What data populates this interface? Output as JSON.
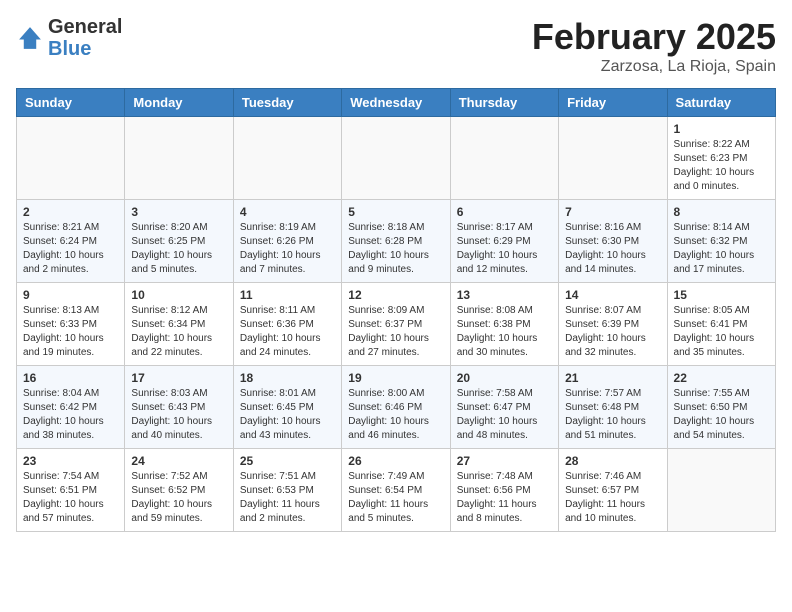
{
  "header": {
    "logo_general": "General",
    "logo_blue": "Blue",
    "month_title": "February 2025",
    "location": "Zarzosa, La Rioja, Spain"
  },
  "days_of_week": [
    "Sunday",
    "Monday",
    "Tuesday",
    "Wednesday",
    "Thursday",
    "Friday",
    "Saturday"
  ],
  "weeks": [
    [
      {
        "day": "",
        "info": ""
      },
      {
        "day": "",
        "info": ""
      },
      {
        "day": "",
        "info": ""
      },
      {
        "day": "",
        "info": ""
      },
      {
        "day": "",
        "info": ""
      },
      {
        "day": "",
        "info": ""
      },
      {
        "day": "1",
        "info": "Sunrise: 8:22 AM\nSunset: 6:23 PM\nDaylight: 10 hours\nand 0 minutes."
      }
    ],
    [
      {
        "day": "2",
        "info": "Sunrise: 8:21 AM\nSunset: 6:24 PM\nDaylight: 10 hours\nand 2 minutes."
      },
      {
        "day": "3",
        "info": "Sunrise: 8:20 AM\nSunset: 6:25 PM\nDaylight: 10 hours\nand 5 minutes."
      },
      {
        "day": "4",
        "info": "Sunrise: 8:19 AM\nSunset: 6:26 PM\nDaylight: 10 hours\nand 7 minutes."
      },
      {
        "day": "5",
        "info": "Sunrise: 8:18 AM\nSunset: 6:28 PM\nDaylight: 10 hours\nand 9 minutes."
      },
      {
        "day": "6",
        "info": "Sunrise: 8:17 AM\nSunset: 6:29 PM\nDaylight: 10 hours\nand 12 minutes."
      },
      {
        "day": "7",
        "info": "Sunrise: 8:16 AM\nSunset: 6:30 PM\nDaylight: 10 hours\nand 14 minutes."
      },
      {
        "day": "8",
        "info": "Sunrise: 8:14 AM\nSunset: 6:32 PM\nDaylight: 10 hours\nand 17 minutes."
      }
    ],
    [
      {
        "day": "9",
        "info": "Sunrise: 8:13 AM\nSunset: 6:33 PM\nDaylight: 10 hours\nand 19 minutes."
      },
      {
        "day": "10",
        "info": "Sunrise: 8:12 AM\nSunset: 6:34 PM\nDaylight: 10 hours\nand 22 minutes."
      },
      {
        "day": "11",
        "info": "Sunrise: 8:11 AM\nSunset: 6:36 PM\nDaylight: 10 hours\nand 24 minutes."
      },
      {
        "day": "12",
        "info": "Sunrise: 8:09 AM\nSunset: 6:37 PM\nDaylight: 10 hours\nand 27 minutes."
      },
      {
        "day": "13",
        "info": "Sunrise: 8:08 AM\nSunset: 6:38 PM\nDaylight: 10 hours\nand 30 minutes."
      },
      {
        "day": "14",
        "info": "Sunrise: 8:07 AM\nSunset: 6:39 PM\nDaylight: 10 hours\nand 32 minutes."
      },
      {
        "day": "15",
        "info": "Sunrise: 8:05 AM\nSunset: 6:41 PM\nDaylight: 10 hours\nand 35 minutes."
      }
    ],
    [
      {
        "day": "16",
        "info": "Sunrise: 8:04 AM\nSunset: 6:42 PM\nDaylight: 10 hours\nand 38 minutes."
      },
      {
        "day": "17",
        "info": "Sunrise: 8:03 AM\nSunset: 6:43 PM\nDaylight: 10 hours\nand 40 minutes."
      },
      {
        "day": "18",
        "info": "Sunrise: 8:01 AM\nSunset: 6:45 PM\nDaylight: 10 hours\nand 43 minutes."
      },
      {
        "day": "19",
        "info": "Sunrise: 8:00 AM\nSunset: 6:46 PM\nDaylight: 10 hours\nand 46 minutes."
      },
      {
        "day": "20",
        "info": "Sunrise: 7:58 AM\nSunset: 6:47 PM\nDaylight: 10 hours\nand 48 minutes."
      },
      {
        "day": "21",
        "info": "Sunrise: 7:57 AM\nSunset: 6:48 PM\nDaylight: 10 hours\nand 51 minutes."
      },
      {
        "day": "22",
        "info": "Sunrise: 7:55 AM\nSunset: 6:50 PM\nDaylight: 10 hours\nand 54 minutes."
      }
    ],
    [
      {
        "day": "23",
        "info": "Sunrise: 7:54 AM\nSunset: 6:51 PM\nDaylight: 10 hours\nand 57 minutes."
      },
      {
        "day": "24",
        "info": "Sunrise: 7:52 AM\nSunset: 6:52 PM\nDaylight: 10 hours\nand 59 minutes."
      },
      {
        "day": "25",
        "info": "Sunrise: 7:51 AM\nSunset: 6:53 PM\nDaylight: 11 hours\nand 2 minutes."
      },
      {
        "day": "26",
        "info": "Sunrise: 7:49 AM\nSunset: 6:54 PM\nDaylight: 11 hours\nand 5 minutes."
      },
      {
        "day": "27",
        "info": "Sunrise: 7:48 AM\nSunset: 6:56 PM\nDaylight: 11 hours\nand 8 minutes."
      },
      {
        "day": "28",
        "info": "Sunrise: 7:46 AM\nSunset: 6:57 PM\nDaylight: 11 hours\nand 10 minutes."
      },
      {
        "day": "",
        "info": ""
      }
    ]
  ]
}
